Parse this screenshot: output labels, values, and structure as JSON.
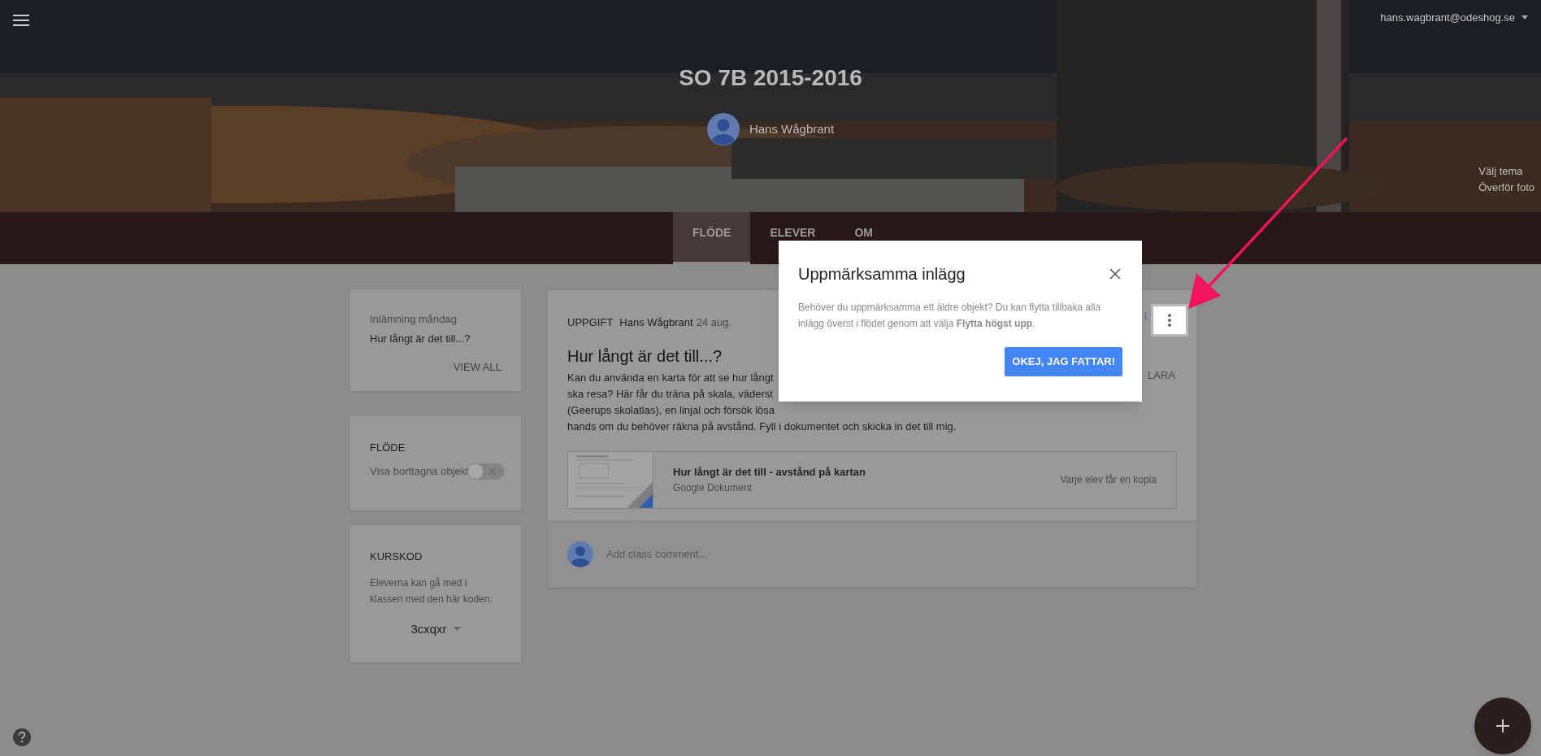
{
  "header": {
    "account": "hans.wagbrant@odeshog.se",
    "title": "SO 7B 2015-2016",
    "teacher": "Hans Wågbrant",
    "links": [
      "Välj tema",
      "Överför foto"
    ]
  },
  "tabs": [
    {
      "label": "FLÖDE",
      "selected": true
    },
    {
      "label": "ELEVER",
      "selected": false
    },
    {
      "label": "OM",
      "selected": false
    }
  ],
  "upcoming": {
    "title": "Inlämning måndag",
    "item": "Hur långt är det till...?",
    "action": "VIEW ALL"
  },
  "stream_settings": {
    "heading": "FLÖDE",
    "toggle": {
      "label": "Visa borttagna objekt",
      "on": false
    }
  },
  "class_code": {
    "heading": "KURSKOD",
    "description": "Eleverna kan gå med i klassen med den här koden:",
    "code": "3cxqxr"
  },
  "post": {
    "type": "UPPGIFT",
    "author": "Hans Wågbrant",
    "date": "24 aug.",
    "title": "Hur långt är det till...?",
    "body_lines": [
      "Kan du använda en karta för att se hur långt",
      "ska resa? Här får du träna på skala, väderst",
      "(Geerups skolatlas), en linjal och försök lösa",
      "hands om du behöver räkna på avstånd. Fyll i dokumentet och skicka in det till mig."
    ],
    "status_fragment": "i.",
    "side_fragment": "LARA",
    "attachment": {
      "title": "Hur långt är det till - avstånd på kartan",
      "kind_label": "Google Dokument",
      "sharing": "Varje elev får en kopia"
    },
    "comment": {
      "placeholder": "Add class comment..."
    }
  },
  "dialog": {
    "title": "Uppmärksamma inlägg",
    "text": "Behöver du uppmärksamma ett äldre objekt? Du kan flytta tillbaka alla inlägg överst i flödet genom att välja **Flytta högst upp**.",
    "button": "OKEJ, JAG FATTAR!"
  }
}
